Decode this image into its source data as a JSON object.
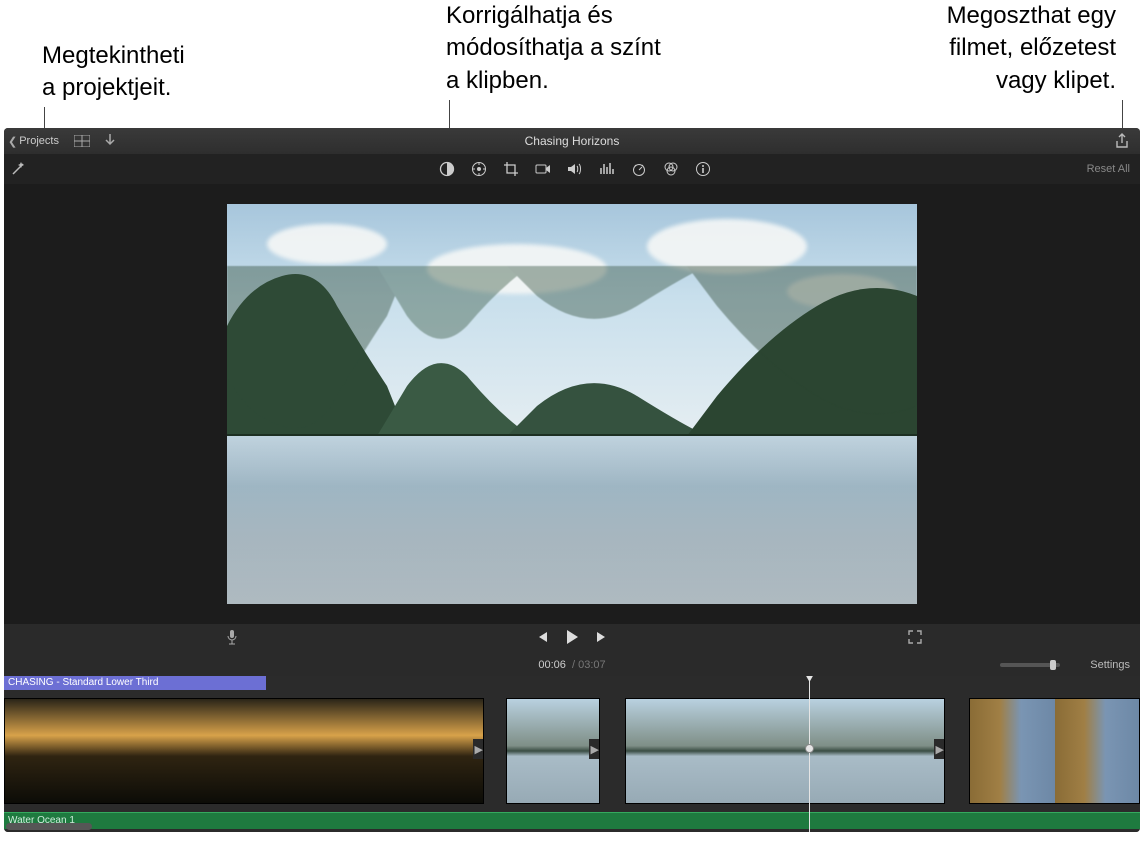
{
  "callouts": {
    "projects": "Megtekintheti\na projektjeit.",
    "projects_l1": "Megtekintheti",
    "projects_l2": "a projektjeit.",
    "color_l1": "Korrigálhatja és",
    "color_l2": "módosíthatja a színt",
    "color_l3": "a klipben.",
    "share_l1": "Megoszthat egy",
    "share_l2": "filmet, előzetest",
    "share_l3": "vagy klipet."
  },
  "titlebar": {
    "projects_label": "Projects",
    "title": "Chasing Horizons"
  },
  "adjustbar": {
    "reset_label": "Reset All"
  },
  "time": {
    "current": "00:06",
    "sep": "/",
    "duration": "03:07",
    "settings_label": "Settings"
  },
  "timeline": {
    "title_overlay": "CHASING - Standard Lower Third",
    "audio_track": "Water Ocean 1"
  }
}
